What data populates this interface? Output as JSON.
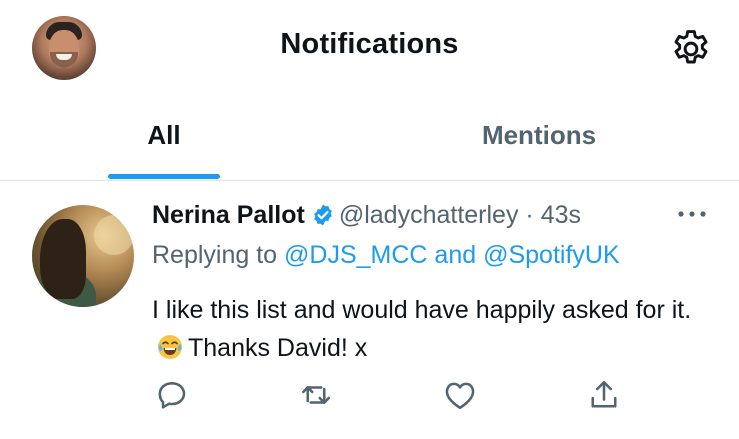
{
  "header": {
    "title": "Notifications",
    "avatar_icon": "user-avatar",
    "settings_icon": "gear-icon"
  },
  "tabs": [
    {
      "label": "All",
      "active": true
    },
    {
      "label": "Mentions",
      "active": false
    }
  ],
  "tweet": {
    "author_name": "Nerina Pallot",
    "verified": true,
    "handle": "@ladychatterley",
    "separator": "·",
    "time": "43s",
    "replying_prefix": "Replying to ",
    "reply_mentions": [
      "@DJS_MCC",
      "@SpotifyUK"
    ],
    "reply_joiner": " and ",
    "text_part1": "I like this list and would have happily asked for it.",
    "emoji": "face-with-tears-of-joy",
    "text_part2": "Thanks David! x",
    "actions": [
      "reply-icon",
      "retweet-icon",
      "like-icon",
      "share-icon"
    ]
  },
  "colors": {
    "accent": "#1d9bf0",
    "text_primary": "#0f1419",
    "text_secondary": "#536471",
    "divider": "#dfe3e6"
  }
}
